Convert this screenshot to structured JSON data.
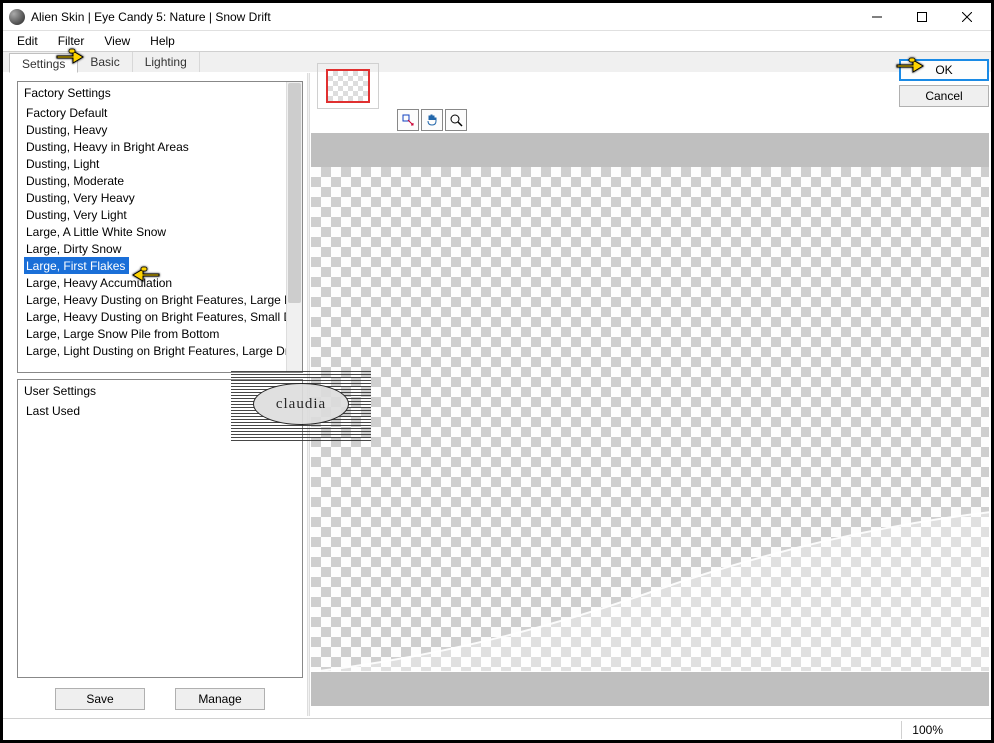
{
  "window": {
    "title": "Alien Skin | Eye Candy 5: Nature | Snow Drift"
  },
  "menu": {
    "edit": "Edit",
    "filter": "Filter",
    "view": "View",
    "help": "Help"
  },
  "tabs": {
    "settings": "Settings",
    "basic": "Basic",
    "lighting": "Lighting"
  },
  "factory": {
    "header": "Factory Settings",
    "items": [
      "Factory Default",
      "Dusting, Heavy",
      "Dusting, Heavy in Bright Areas",
      "Dusting, Light",
      "Dusting, Moderate",
      "Dusting, Very Heavy",
      "Dusting, Very Light",
      "Large, A Little White Snow",
      "Large, Dirty Snow",
      "Large, First Flakes",
      "Large, Heavy Accumulation",
      "Large, Heavy Dusting on Bright Features, Large Drift",
      "Large, Heavy Dusting on Bright Features, Small Drift",
      "Large, Large Snow Pile from Bottom",
      "Large, Light Dusting on Bright Features, Large Drift"
    ],
    "selected_index": 9
  },
  "user": {
    "header": "User Settings",
    "items": [
      "Last Used"
    ]
  },
  "buttons": {
    "save": "Save",
    "manage": "Manage",
    "ok": "OK",
    "cancel": "Cancel"
  },
  "status": {
    "zoom": "100%"
  },
  "watermark": {
    "text": "claudia"
  }
}
